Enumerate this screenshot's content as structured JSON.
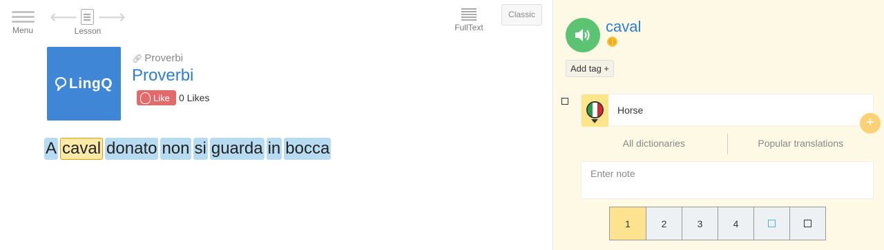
{
  "toolbar": {
    "menu_label": "Menu",
    "lesson_label": "Lesson",
    "fulltext_label": "FullText",
    "classic_label": "Classic"
  },
  "lesson": {
    "course_name": "Proverbi",
    "title": "Proverbi",
    "like_label": "Like",
    "likes_text": "0 Likes",
    "logo_text": "LingQ",
    "sentence": [
      "A",
      "caval",
      "donato",
      "non",
      "si",
      "guarda",
      "in",
      "bocca"
    ],
    "active_word": "caval"
  },
  "term_panel": {
    "term": "caval",
    "add_tag_label": "Add tag +",
    "hint": "Horse",
    "dict_tabs": [
      "All dictionaries",
      "Popular translations"
    ],
    "note_placeholder": "Enter note",
    "statuses": [
      "1",
      "2",
      "3",
      "4"
    ],
    "selected_status": "1"
  },
  "colors": {
    "accent_blue": "#2f7dd1",
    "word_highlight": "#b7dcf2",
    "active_word": "#fde8a8",
    "panel_bg": "#fdf9e4",
    "audio_green": "#5cc373",
    "like_red": "#e36a6a"
  },
  "icons": {
    "menu": "hamburger-icon",
    "lesson": "document-icon",
    "fulltext": "text-lines-icon",
    "audio": "speaker-icon",
    "coin": "coin-icon",
    "flag": "italy-flag-icon",
    "add": "plus-icon"
  }
}
